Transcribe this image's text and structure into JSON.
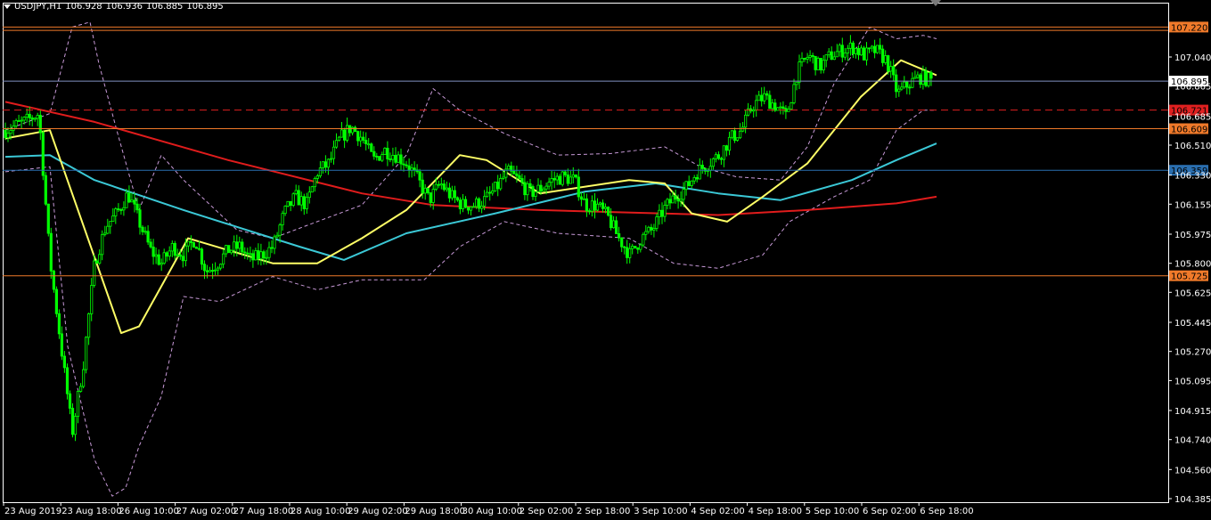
{
  "header": {
    "symbol": "USDJPY,H1",
    "ohlc": [
      "106.928",
      "106.936",
      "106.885",
      "106.895"
    ]
  },
  "chart_data": {
    "type": "candlestick",
    "symbol": "USDJPY",
    "timeframe": "H1",
    "ylim": [
      104.385,
      107.345
    ],
    "price_ticks": [
      "107.040",
      "106.865",
      "106.685",
      "106.510",
      "106.330",
      "106.155",
      "105.975",
      "105.800",
      "105.625",
      "105.445",
      "105.270",
      "105.095",
      "104.915",
      "104.740",
      "104.560",
      "104.385"
    ],
    "time_ticks": [
      "23 Aug 2019",
      "23 Aug 18:00",
      "26 Aug 10:00",
      "27 Aug 02:00",
      "27 Aug 18:00",
      "28 Aug 10:00",
      "29 Aug 02:00",
      "29 Aug 18:00",
      "30 Aug 10:00",
      "2 Sep 02:00",
      "2 Sep 18:00",
      "3 Sep 10:00",
      "4 Sep 02:00",
      "4 Sep 18:00",
      "5 Sep 10:00",
      "6 Sep 02:00",
      "6 Sep 18:00"
    ],
    "levels": [
      {
        "price": 107.22,
        "label": "107.220",
        "color": "#f07a2a",
        "style": "solid"
      },
      {
        "price": 107.2,
        "label": "",
        "color": "#f07a2a",
        "style": "solid"
      },
      {
        "price": 106.895,
        "label": "106.895",
        "color": "#8090c0",
        "style": "solid"
      },
      {
        "price": 106.721,
        "label": "106.721",
        "color": "#e02020",
        "style": "dashed"
      },
      {
        "price": 106.609,
        "label": "106.609",
        "color": "#f07a2a",
        "style": "solid"
      },
      {
        "price": 106.359,
        "label": "106.359",
        "color": "#2a6fb0",
        "style": "solid"
      },
      {
        "price": 105.725,
        "label": "105.725",
        "color": "#f07a2a",
        "style": "solid"
      }
    ],
    "close_anchors": [
      106.6,
      106.63,
      106.66,
      106.7,
      105.82,
      105.3,
      104.78,
      105.2,
      105.8,
      106.02,
      106.1,
      106.22,
      106.05,
      105.88,
      105.8,
      105.9,
      105.85,
      105.95,
      105.75,
      105.8,
      105.88,
      105.9,
      105.82,
      105.85,
      105.9,
      106.1,
      106.2,
      106.15,
      106.35,
      106.4,
      106.55,
      106.62,
      106.55,
      106.42,
      106.48,
      106.45,
      106.4,
      106.3,
      106.18,
      106.28,
      106.2,
      106.15,
      106.15,
      106.18,
      106.25,
      106.35,
      106.3,
      106.22,
      106.25,
      106.3,
      106.32,
      106.3,
      106.15,
      106.15,
      106.08,
      105.95,
      105.85,
      105.95,
      106.0,
      106.12,
      106.2,
      106.25,
      106.35,
      106.4,
      106.45,
      106.55,
      106.6,
      106.75,
      106.8,
      106.75,
      106.68,
      106.95,
      107.05,
      106.98,
      107.05,
      107.08,
      107.1,
      107.05,
      107.08,
      107.02,
      106.82,
      106.88,
      106.92,
      106.9
    ],
    "ma_fast": [
      [
        0,
        106.55
      ],
      [
        50,
        106.6
      ],
      [
        130,
        105.38
      ],
      [
        150,
        105.42
      ],
      [
        205,
        105.95
      ],
      [
        300,
        105.8
      ],
      [
        350,
        105.8
      ],
      [
        400,
        105.95
      ],
      [
        450,
        106.12
      ],
      [
        510,
        106.45
      ],
      [
        540,
        106.42
      ],
      [
        600,
        106.22
      ],
      [
        700,
        106.3
      ],
      [
        740,
        106.28
      ],
      [
        770,
        106.1
      ],
      [
        810,
        106.05
      ],
      [
        850,
        106.2
      ],
      [
        900,
        106.4
      ],
      [
        960,
        106.8
      ],
      [
        1005,
        107.02
      ],
      [
        1045,
        106.93
      ]
    ],
    "ma_mid": [
      [
        0,
        106.44
      ],
      [
        50,
        106.45
      ],
      [
        100,
        106.3
      ],
      [
        200,
        106.12
      ],
      [
        330,
        105.9
      ],
      [
        380,
        105.82
      ],
      [
        450,
        105.98
      ],
      [
        550,
        106.1
      ],
      [
        650,
        106.23
      ],
      [
        730,
        106.28
      ],
      [
        800,
        106.22
      ],
      [
        870,
        106.18
      ],
      [
        950,
        106.3
      ],
      [
        1000,
        106.42
      ],
      [
        1045,
        106.52
      ]
    ],
    "ma_slow": [
      [
        0,
        106.77
      ],
      [
        100,
        106.65
      ],
      [
        250,
        106.42
      ],
      [
        400,
        106.22
      ],
      [
        480,
        106.15
      ],
      [
        600,
        106.12
      ],
      [
        800,
        106.09
      ],
      [
        900,
        106.12
      ],
      [
        1000,
        106.16
      ],
      [
        1045,
        106.2
      ]
    ],
    "bb_upper": [
      [
        0,
        106.6
      ],
      [
        50,
        106.7
      ],
      [
        75,
        107.22
      ],
      [
        95,
        107.25
      ],
      [
        105,
        107.0
      ],
      [
        125,
        106.6
      ],
      [
        150,
        106.12
      ],
      [
        175,
        106.45
      ],
      [
        200,
        106.3
      ],
      [
        260,
        106.0
      ],
      [
        300,
        105.95
      ],
      [
        350,
        106.05
      ],
      [
        400,
        106.15
      ],
      [
        450,
        106.45
      ],
      [
        480,
        106.85
      ],
      [
        510,
        106.72
      ],
      [
        560,
        106.58
      ],
      [
        620,
        106.45
      ],
      [
        680,
        106.46
      ],
      [
        740,
        106.5
      ],
      [
        780,
        106.38
      ],
      [
        820,
        106.32
      ],
      [
        870,
        106.3
      ],
      [
        900,
        106.5
      ],
      [
        930,
        106.88
      ],
      [
        970,
        107.22
      ],
      [
        1000,
        107.15
      ],
      [
        1030,
        107.17
      ],
      [
        1045,
        107.15
      ]
    ],
    "bb_lower": [
      [
        0,
        106.35
      ],
      [
        50,
        106.38
      ],
      [
        70,
        105.3
      ],
      [
        100,
        104.62
      ],
      [
        120,
        104.4
      ],
      [
        135,
        104.45
      ],
      [
        150,
        104.7
      ],
      [
        175,
        105.0
      ],
      [
        200,
        105.6
      ],
      [
        240,
        105.57
      ],
      [
        300,
        105.72
      ],
      [
        350,
        105.64
      ],
      [
        400,
        105.7
      ],
      [
        470,
        105.7
      ],
      [
        510,
        105.9
      ],
      [
        560,
        106.05
      ],
      [
        620,
        105.98
      ],
      [
        700,
        105.95
      ],
      [
        750,
        105.8
      ],
      [
        800,
        105.77
      ],
      [
        850,
        105.85
      ],
      [
        880,
        106.05
      ],
      [
        930,
        106.2
      ],
      [
        970,
        106.3
      ],
      [
        1000,
        106.6
      ],
      [
        1030,
        106.72
      ],
      [
        1045,
        106.72
      ]
    ]
  },
  "colors": {
    "background": "#000000",
    "candle": "#00ff00",
    "grid_text": "#ffffff",
    "ma_fast": "#ffff66",
    "ma_mid": "#3bc8d6",
    "ma_slow": "#e01c1c",
    "bollinger": "#c89ad8"
  }
}
